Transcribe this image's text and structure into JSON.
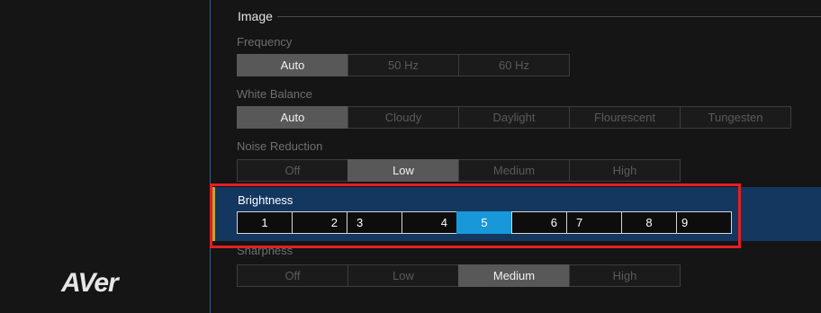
{
  "logo_text": "AVer",
  "section": {
    "title": "Image"
  },
  "frequency": {
    "label": "Frequency",
    "options": [
      "Auto",
      "50 Hz",
      "60 Hz"
    ],
    "selected": "Auto"
  },
  "white_balance": {
    "label": "White Balance",
    "options": [
      "Auto",
      "Cloudy",
      "Daylight",
      "Flourescent",
      "Tungesten"
    ],
    "selected": "Auto"
  },
  "noise_reduction": {
    "label": "Noise Reduction",
    "options": [
      "Off",
      "Low",
      "Medium",
      "High"
    ],
    "selected": "Low"
  },
  "brightness": {
    "label": "Brightness",
    "options": [
      "1",
      "2",
      "3",
      "4",
      "5",
      "6",
      "7",
      "8",
      "9"
    ],
    "selected": "5"
  },
  "sharpness": {
    "label": "Sharpness",
    "options": [
      "Off",
      "Low",
      "Medium",
      "High"
    ],
    "selected": "Medium"
  },
  "colors": {
    "highlight_row": "#14375f",
    "selected_number": "#1898d9",
    "annotation_box": "#e32024",
    "accent_bar": "#b7a63a"
  }
}
